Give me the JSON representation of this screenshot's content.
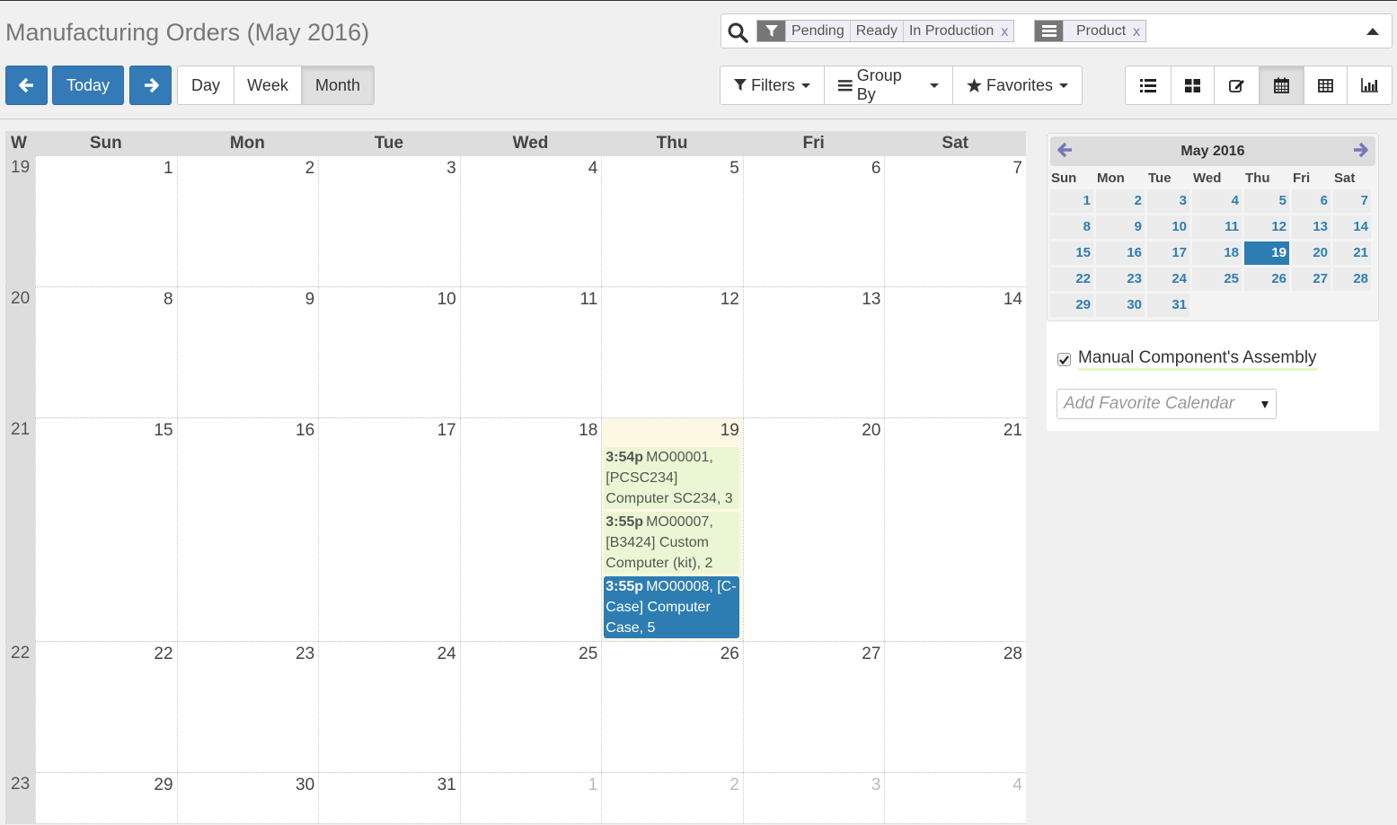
{
  "header": {
    "title": "Manufacturing Orders (May 2016)",
    "search": {
      "facets": [
        {
          "icon": "filter-icon",
          "values": [
            "Pending",
            "Ready",
            "In Production"
          ],
          "remove": "x"
        },
        {
          "icon": "group-by-icon",
          "values": [
            "Product"
          ],
          "remove": "x"
        }
      ]
    },
    "nav": {
      "prev_icon": "arrow-left-icon",
      "today_label": "Today",
      "next_icon": "arrow-right-icon"
    },
    "scale_buttons": [
      {
        "label": "Day",
        "active": false
      },
      {
        "label": "Week",
        "active": false
      },
      {
        "label": "Month",
        "active": true
      }
    ],
    "search_options": [
      {
        "icon": "filter-icon",
        "label": "Filters"
      },
      {
        "icon": "bars-icon",
        "label": "Group By"
      },
      {
        "icon": "star-icon",
        "label": "Favorites"
      }
    ],
    "view_switcher": [
      {
        "icon": "list-view-icon",
        "active": false
      },
      {
        "icon": "kanban-view-icon",
        "active": false
      },
      {
        "icon": "form-view-icon",
        "active": false
      },
      {
        "icon": "calendar-view-icon",
        "active": true
      },
      {
        "icon": "pivot-view-icon",
        "active": false
      },
      {
        "icon": "graph-view-icon",
        "active": false
      }
    ]
  },
  "calendar": {
    "week_col_label": "W",
    "weekdays": [
      "Sun",
      "Mon",
      "Tue",
      "Wed",
      "Thu",
      "Fri",
      "Sat"
    ],
    "weeks": [
      {
        "week": "19",
        "days": [
          {
            "d": "1"
          },
          {
            "d": "2"
          },
          {
            "d": "3"
          },
          {
            "d": "4"
          },
          {
            "d": "5"
          },
          {
            "d": "6"
          },
          {
            "d": "7"
          }
        ]
      },
      {
        "week": "20",
        "days": [
          {
            "d": "8"
          },
          {
            "d": "9"
          },
          {
            "d": "10"
          },
          {
            "d": "11"
          },
          {
            "d": "12"
          },
          {
            "d": "13"
          },
          {
            "d": "14"
          }
        ]
      },
      {
        "week": "21",
        "days": [
          {
            "d": "15"
          },
          {
            "d": "16"
          },
          {
            "d": "17"
          },
          {
            "d": "18"
          },
          {
            "d": "19",
            "today": true,
            "events": [
              {
                "time": "3:54p",
                "text": "MO00001, [PCSC234] Computer SC234, 3",
                "style": "pending"
              },
              {
                "time": "3:55p",
                "text": "MO00007, [B3424] Custom Computer (kit), 2",
                "style": "pending"
              },
              {
                "time": "3:55p",
                "text": "MO00008, [C-Case] Computer Case, 5",
                "style": "active"
              }
            ]
          },
          {
            "d": "20"
          },
          {
            "d": "21"
          }
        ]
      },
      {
        "week": "22",
        "days": [
          {
            "d": "22"
          },
          {
            "d": "23"
          },
          {
            "d": "24"
          },
          {
            "d": "25"
          },
          {
            "d": "26"
          },
          {
            "d": "27"
          },
          {
            "d": "28"
          }
        ]
      },
      {
        "week": "23",
        "days": [
          {
            "d": "29"
          },
          {
            "d": "30"
          },
          {
            "d": "31"
          },
          {
            "d": "1",
            "other": true
          },
          {
            "d": "2",
            "other": true
          },
          {
            "d": "3",
            "other": true
          },
          {
            "d": "4",
            "other": true
          }
        ]
      }
    ]
  },
  "sidebar": {
    "mini_calendar": {
      "title": "May 2016",
      "weekdays": [
        "Sun",
        "Mon",
        "Tue",
        "Wed",
        "Thu",
        "Fri",
        "Sat"
      ],
      "selected": "19",
      "weeks": [
        [
          "1",
          "2",
          "3",
          "4",
          "5",
          "6",
          "7"
        ],
        [
          "8",
          "9",
          "10",
          "11",
          "12",
          "13",
          "14"
        ],
        [
          "15",
          "16",
          "17",
          "18",
          "19",
          "20",
          "21"
        ],
        [
          "22",
          "23",
          "24",
          "25",
          "26",
          "27",
          "28"
        ],
        [
          "29",
          "30",
          "31",
          "",
          "",
          "",
          ""
        ]
      ]
    },
    "filter": {
      "label": "Manual Component's Assembly",
      "checked": true
    },
    "favorite_placeholder": "Add Favorite Calendar"
  },
  "colors": {
    "primary": "#337ab7",
    "event_pending": "#ebf7d4",
    "event_active": "#2d7db3",
    "today_bg": "#fcf8e3"
  }
}
